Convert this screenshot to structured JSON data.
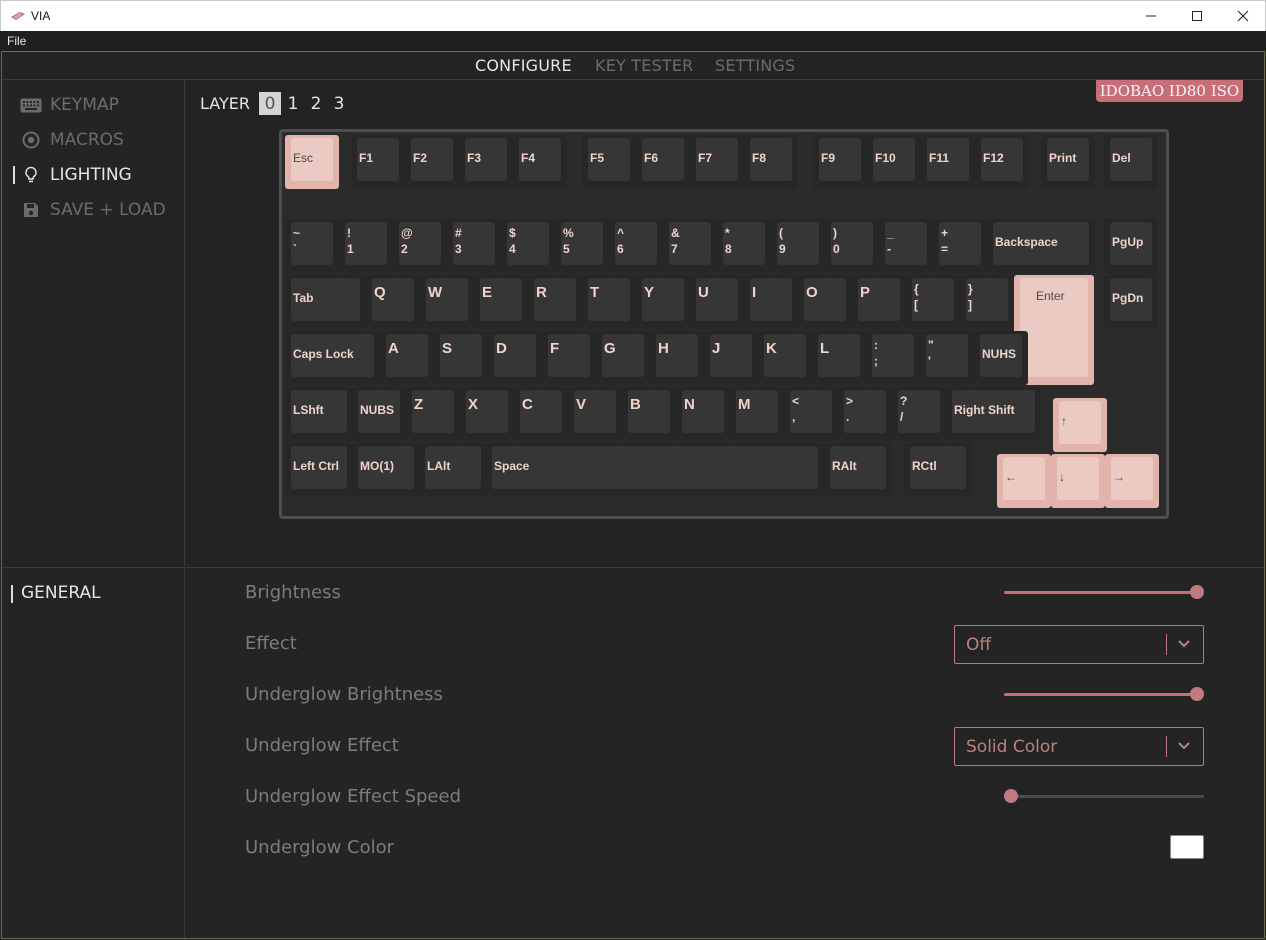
{
  "window": {
    "title": "VIA",
    "min_icon": "minimize-icon",
    "max_icon": "maximize-icon",
    "close_icon": "close-icon"
  },
  "menubar": {
    "file": "File"
  },
  "topnav": {
    "tabs": [
      "CONFIGURE",
      "KEY TESTER",
      "SETTINGS"
    ],
    "active": "CONFIGURE"
  },
  "leftmenu": {
    "items": [
      {
        "label": "KEYMAP",
        "icon": "keyboard-icon"
      },
      {
        "label": "MACROS",
        "icon": "record-icon"
      },
      {
        "label": "LIGHTING",
        "icon": "lightbulb-icon"
      },
      {
        "label": "SAVE + LOAD",
        "icon": "floppy-disk-icon"
      }
    ],
    "active": "LIGHTING"
  },
  "layers": {
    "label": "LAYER",
    "items": [
      "0",
      "1",
      "2",
      "3"
    ],
    "active": "0"
  },
  "keyboard": {
    "name": "IDOBAO ID80 ISO",
    "rows": [
      [
        "Esc",
        "F1",
        "F2",
        "F3",
        "F4",
        "F5",
        "F6",
        "F7",
        "F8",
        "F9",
        "F10",
        "F11",
        "F12",
        "Print",
        "Del"
      ],
      [
        "~\n`",
        "!\n1",
        "@\n2",
        "#\n3",
        "$\n4",
        "%\n5",
        "^\n6",
        "&\n7",
        "*\n8",
        "(\n9",
        ")\n0",
        "_\n-",
        "+\n=",
        "Backspace",
        "PgUp"
      ],
      [
        "Tab",
        "Q",
        "W",
        "E",
        "R",
        "T",
        "Y",
        "U",
        "I",
        "O",
        "P",
        "{\n[",
        "}\n]",
        "Enter",
        "PgDn"
      ],
      [
        "Caps Lock",
        "A",
        "S",
        "D",
        "F",
        "G",
        "H",
        "J",
        "K",
        "L",
        ":\n;",
        "\"\n'",
        "NUHS"
      ],
      [
        "LShft",
        "NUBS",
        "Z",
        "X",
        "C",
        "V",
        "B",
        "N",
        "M",
        "<\n,",
        ">\n.",
        "?\n/",
        "Right Shift",
        "↑"
      ],
      [
        "Left Ctrl",
        "MO(1)",
        "LAlt",
        "Space",
        "RAlt",
        "RCtl",
        "←",
        "↓",
        "→"
      ]
    ]
  },
  "lighting": {
    "section": "GENERAL",
    "brightness": {
      "label": "Brightness",
      "value": 1.0
    },
    "effect": {
      "label": "Effect",
      "value": "Off"
    },
    "underglow_brightness": {
      "label": "Underglow Brightness",
      "value": 1.0
    },
    "underglow_effect": {
      "label": "Underglow Effect",
      "value": "Solid Color"
    },
    "underglow_effect_speed": {
      "label": "Underglow Effect Speed",
      "value": 0.0
    },
    "underglow_color": {
      "label": "Underglow Color",
      "value": "#ffffff"
    }
  },
  "colors": {
    "accent": "#c86e78",
    "keycap_accent": "#eccac4",
    "legend": "#f0d4cc"
  }
}
